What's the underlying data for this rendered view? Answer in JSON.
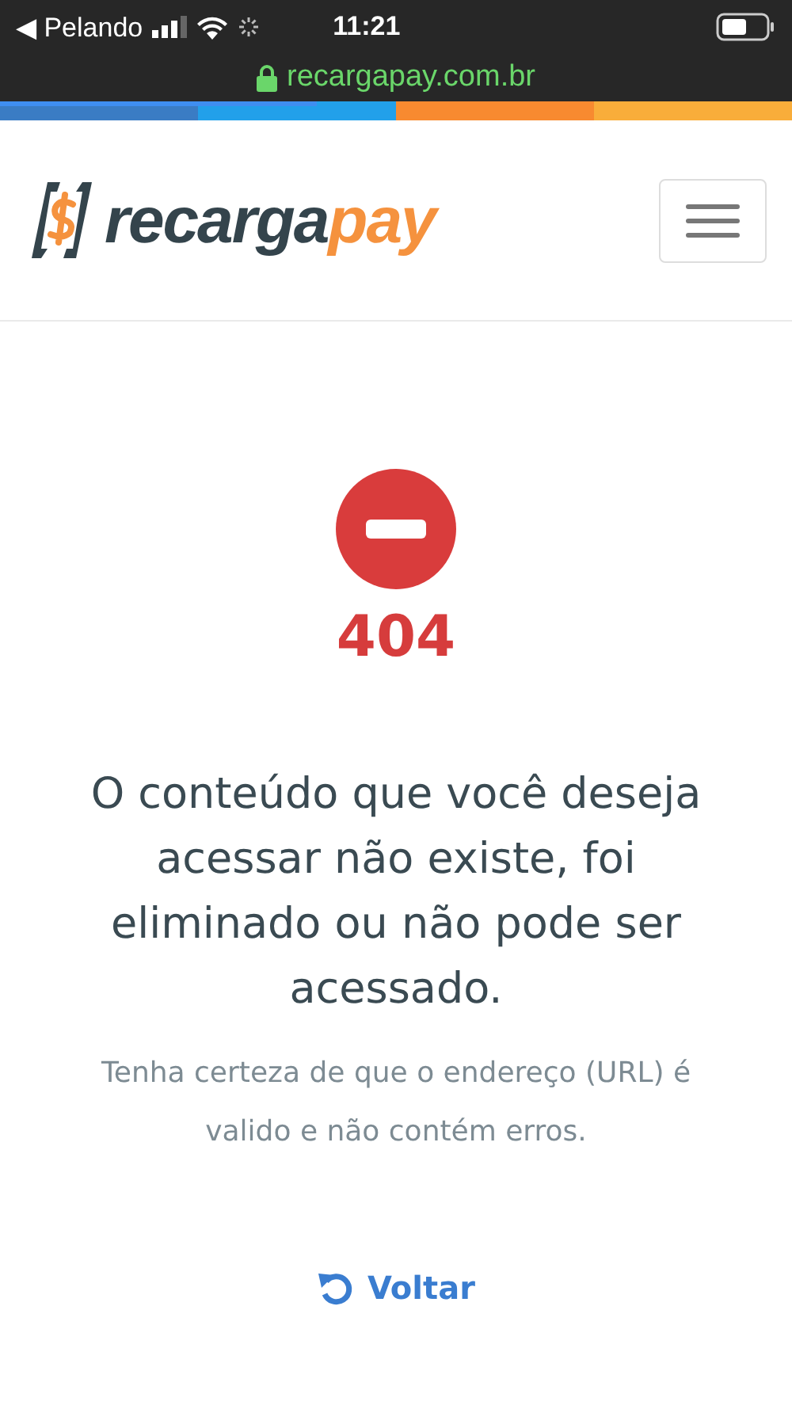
{
  "status_bar": {
    "back_label": "◀ Pelando",
    "time": "11:21"
  },
  "address_bar": {
    "url": "recargapay.com.br"
  },
  "page_load": {
    "level": 0.4
  },
  "logo": {
    "text_1": "recarga",
    "text_2": "pay"
  },
  "error": {
    "code": "404",
    "title": "O conteúdo que você deseja acessar não existe, foi eliminado ou não pode ser acessado.",
    "hint": "Tenha certeza de que o endereço (URL) é valido e não contém erros.",
    "back_link": "Voltar"
  }
}
